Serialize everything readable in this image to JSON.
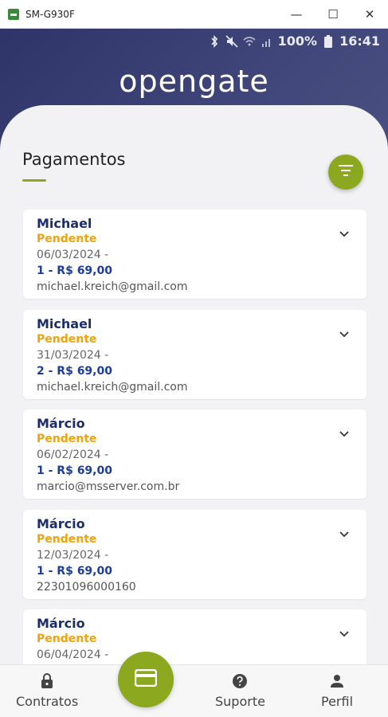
{
  "window": {
    "title": "SM-G930F",
    "minimize_glyph": "—",
    "maximize_glyph": "☐",
    "close_glyph": "✕"
  },
  "statusbar": {
    "icons": [
      "bluetooth-icon",
      "mute-icon",
      "wifi-icon",
      "signal-icon",
      "battery-icon"
    ],
    "battery": "100%",
    "time": "16:41"
  },
  "app": {
    "logo": "opengate"
  },
  "page": {
    "title": "Pagamentos"
  },
  "payments": [
    {
      "name": "Michael",
      "status": "Pendente",
      "date": "06/03/2024 -",
      "amount": "1 - R$ 69,00",
      "detail": "michael.kreich@gmail.com"
    },
    {
      "name": "Michael",
      "status": "Pendente",
      "date": "31/03/2024 -",
      "amount": "2 - R$ 69,00",
      "detail": "michael.kreich@gmail.com"
    },
    {
      "name": "Márcio",
      "status": "Pendente",
      "date": "06/02/2024 -",
      "amount": "1 - R$ 69,00",
      "detail": "marcio@msserver.com.br"
    },
    {
      "name": "Márcio",
      "status": "Pendente",
      "date": "12/03/2024 -",
      "amount": "1 - R$ 69,00",
      "detail": "22301096000160"
    },
    {
      "name": "Márcio",
      "status": "Pendente",
      "date": "06/04/2024 -",
      "amount": "",
      "detail": ""
    }
  ],
  "nav": {
    "contratos": "Contratos",
    "suporte": "Suporte",
    "perfil": "Perfil"
  },
  "colors": {
    "accent": "#8ba81f",
    "header": "#3a3f72",
    "pending": "#f0a30a",
    "name": "#1c2d6b"
  }
}
